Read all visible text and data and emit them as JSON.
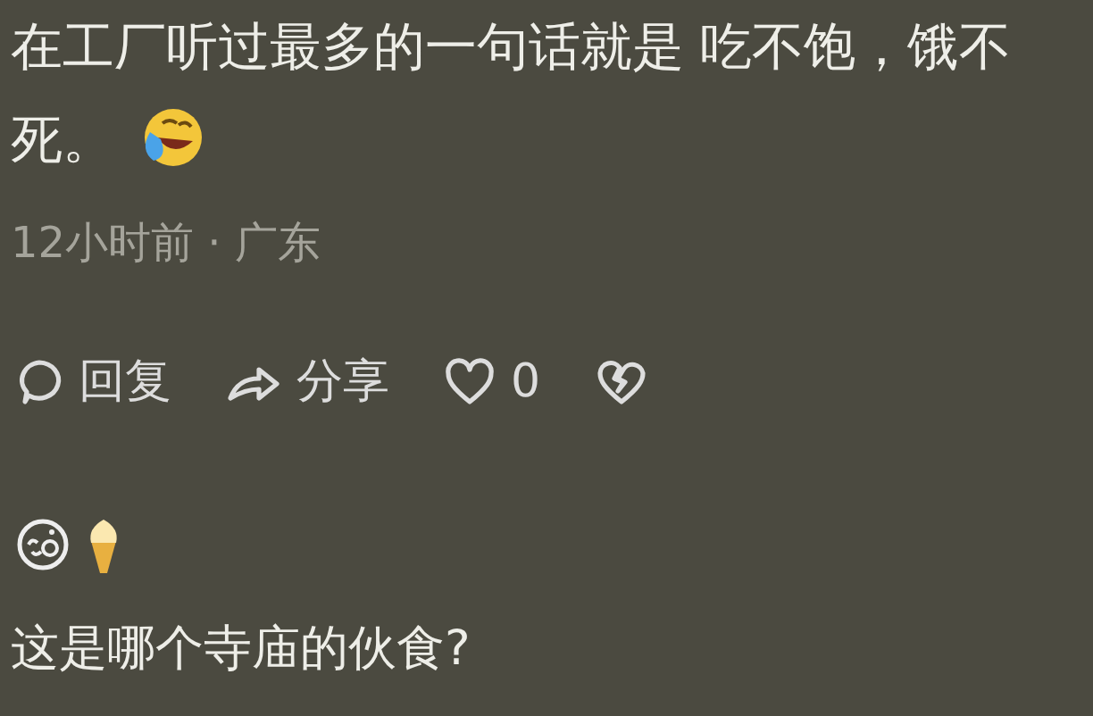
{
  "comment": {
    "lines": [
      "在工厂听过最多的一句话就是 吃不饱，饿不",
      "死。"
    ],
    "meta": "12小时前 · 广东",
    "actions": [
      {
        "kind": "reply",
        "label": "回复"
      },
      {
        "kind": "share",
        "label": "分享"
      },
      {
        "kind": "like",
        "label": "0"
      },
      {
        "kind": "dislike"
      }
    ]
  },
  "next_comment": {
    "text": "这是哪个寺庙的伙食?"
  }
}
